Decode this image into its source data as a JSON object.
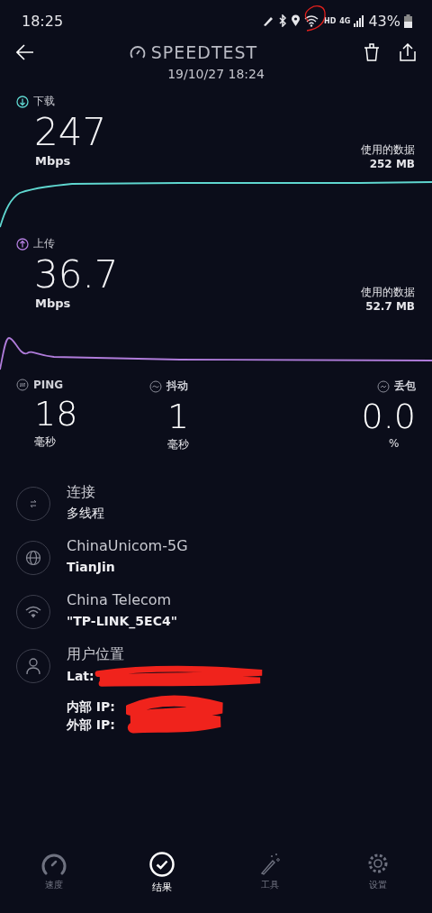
{
  "status_bar": {
    "time": "18:25",
    "network_badge": "HD",
    "network_type": "4G",
    "battery": "43%"
  },
  "header": {
    "title": "SPEEDTEST",
    "date": "19/10/27 18:24"
  },
  "speeds": [
    {
      "kind": "download",
      "label": "下载",
      "value": "247",
      "unit": "Mbps",
      "data_label": "使用的数据",
      "data_value": "252 MB",
      "color": "#5fd6cf"
    },
    {
      "kind": "upload",
      "label": "上传",
      "value": "36.7",
      "unit": "Mbps",
      "data_label": "使用的数据",
      "data_value": "52.7 MB",
      "color": "#b07cdb"
    }
  ],
  "metrics": [
    {
      "kind": "ping",
      "label": "PING",
      "value": "18",
      "unit": "毫秒"
    },
    {
      "kind": "jitter",
      "label": "抖动",
      "value": "1",
      "unit": "毫秒"
    },
    {
      "kind": "loss",
      "label": "丢包",
      "value": "0.0",
      "unit": "%"
    }
  ],
  "details": [
    {
      "kind": "connection",
      "title": "连接",
      "subtitle": "多线程"
    },
    {
      "kind": "server",
      "title": "ChinaUnicom-5G",
      "subtitle": "TianJin"
    },
    {
      "kind": "wifi",
      "title": "China Telecom",
      "subtitle": "\"TP-LINK_5EC4\""
    },
    {
      "kind": "user",
      "title": "用户位置",
      "subtitle": "Lat:",
      "ip_lines": [
        "内部 IP:",
        "外部 IP:"
      ]
    }
  ],
  "nav": [
    {
      "kind": "speed",
      "label": "速度",
      "selected": false
    },
    {
      "kind": "results",
      "label": "结果",
      "selected": true
    },
    {
      "kind": "tools",
      "label": "工具",
      "selected": false
    },
    {
      "kind": "settings",
      "label": "设置",
      "selected": false
    }
  ]
}
